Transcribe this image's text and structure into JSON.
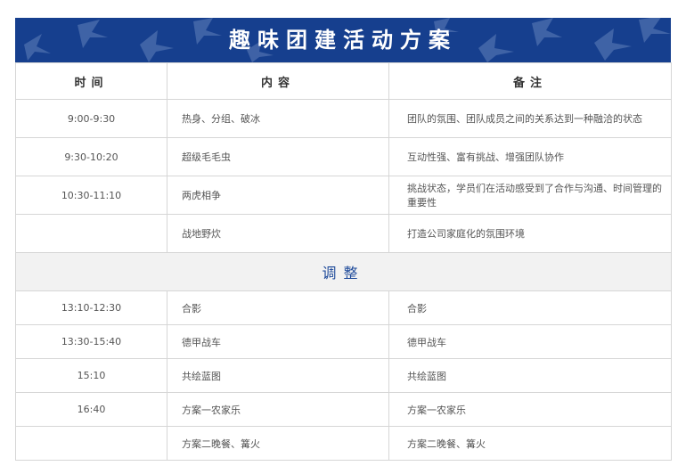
{
  "title": "趣味团建活动方案",
  "colors": {
    "banner": "#163f8e",
    "separator_bg": "#f2f2f2",
    "separator_text": "#1e4a9a"
  },
  "headers": [
    "时间",
    "内容",
    "备注"
  ],
  "morning_rows": [
    {
      "time": "9:00-9:30",
      "content": "热身、分组、破冰",
      "note": "团队的氛围、团队成员之间的关系达到一种融洽的状态"
    },
    {
      "time": "9:30-10:20",
      "content": "超级毛毛虫",
      "note": "互动性强、富有挑战、增强团队协作"
    },
    {
      "time": "10:30-11:10",
      "content": "两虎相争",
      "note": "挑战状态，学员们在活动感受到了合作与沟通、时间管理的重要性"
    },
    {
      "time": "",
      "content": "战地野炊",
      "note": "打造公司家庭化的氛围环境"
    }
  ],
  "separator": "调整",
  "afternoon_rows": [
    {
      "time": "13:10-12:30",
      "content": "合影",
      "note": "合影"
    },
    {
      "time": "13:30-15:40",
      "content": "德甲战车",
      "note": "德甲战车"
    },
    {
      "time": "15:10",
      "content": "共绘蓝图",
      "note": "共绘蓝图"
    },
    {
      "time": "16:40",
      "content": "方案一农家乐",
      "note": "方案一农家乐"
    },
    {
      "time": "",
      "content": "方案二晚餐、篝火",
      "note": "方案二晚餐、篝火"
    }
  ]
}
